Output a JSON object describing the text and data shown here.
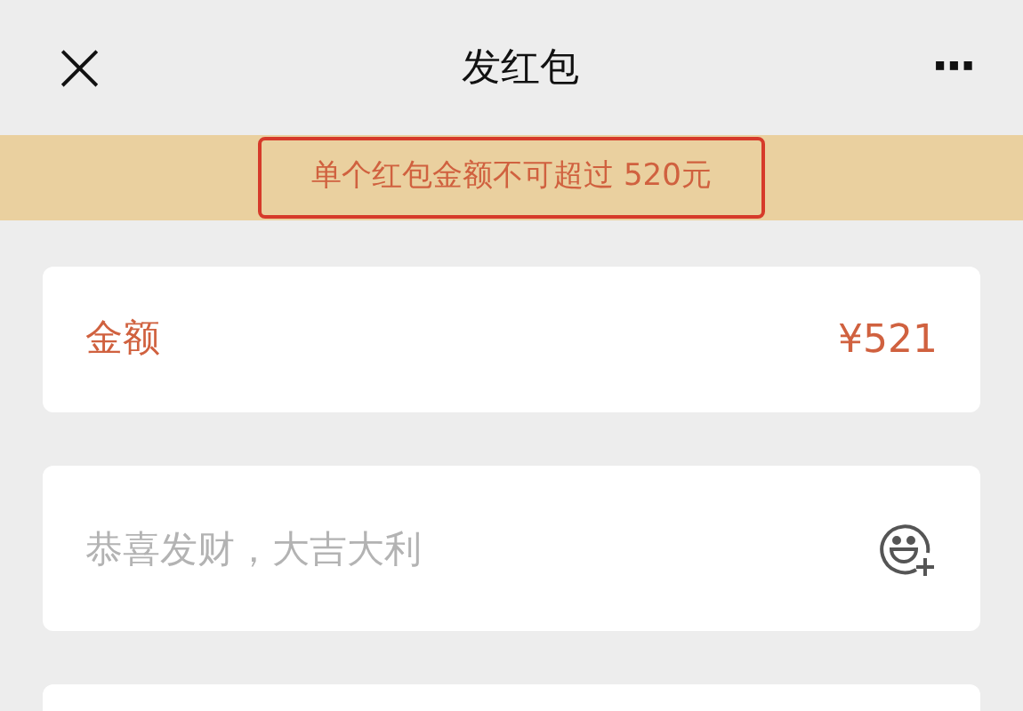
{
  "header": {
    "close": "×",
    "title": "发红包",
    "more": "···"
  },
  "notice": {
    "text": "单个红包金额不可超过 520元",
    "highlighted": true
  },
  "amount": {
    "label": "金额",
    "value": "¥521",
    "error": true
  },
  "greeting": {
    "placeholder": "恭喜发财，大吉大利"
  }
}
